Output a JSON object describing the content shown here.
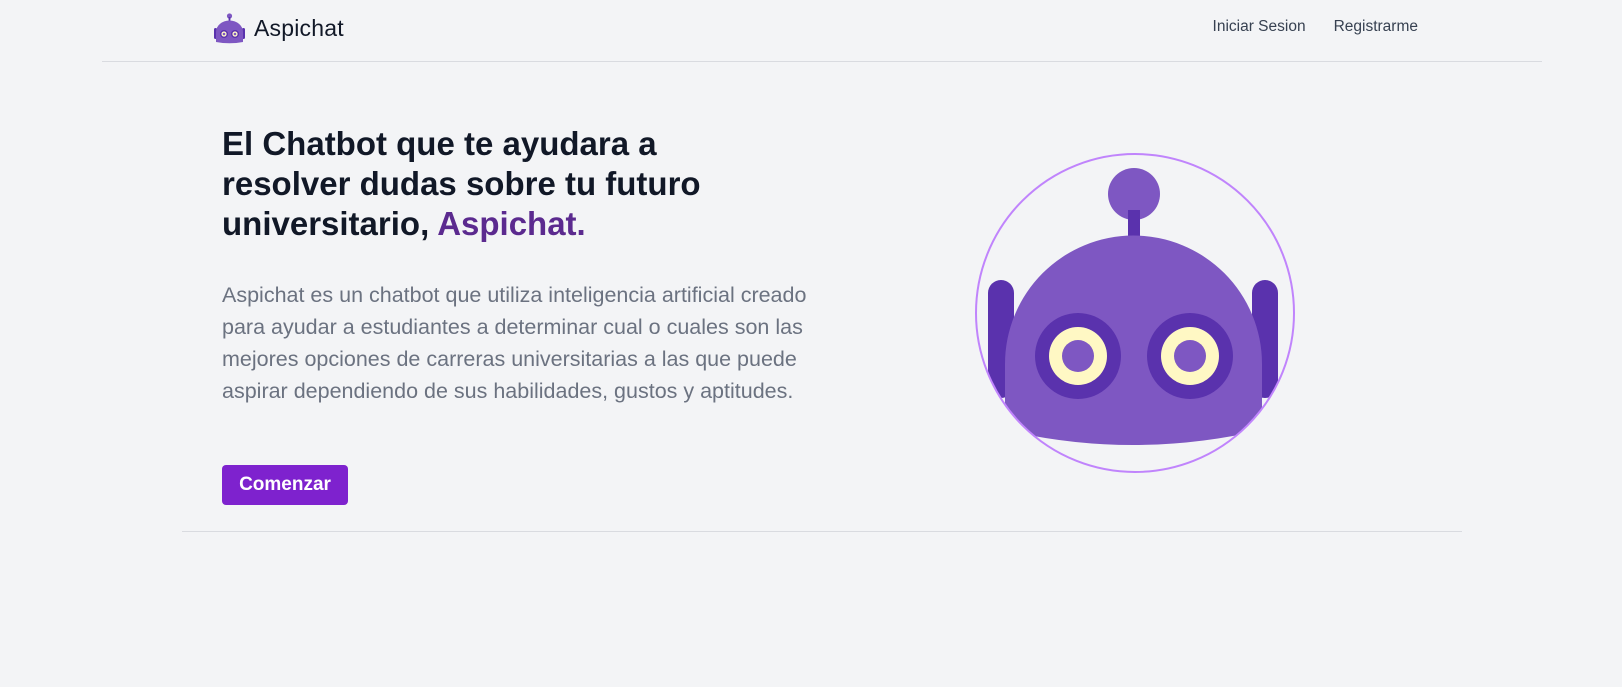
{
  "brand": {
    "name": "Aspichat",
    "logo_icon": "robot-icon",
    "color": "#7e57c2"
  },
  "nav": {
    "login_label": "Iniciar Sesion",
    "register_label": "Registrarme"
  },
  "hero": {
    "title_prefix": "El Chatbot que te ayudara a resolver dudas sobre tu futuro universitario, ",
    "title_highlight": "Aspichat.",
    "description": "Aspichat es un chatbot que utiliza inteligencia artificial creado para ayudar a estudiantes a determinar cual o cuales son las mejores opciones de carreras universitarias a las que puede aspirar dependiendo de sus habilidades, gustos y aptitudes.",
    "cta_label": "Comenzar",
    "illustration_icon": "robot-icon"
  },
  "colors": {
    "accent": "#7e22ce",
    "highlight_text": "#5b2a8f",
    "robot_body": "#7e57c2",
    "robot_dark": "#5a32ad",
    "robot_eye": "#fff8c4",
    "circle_outline": "#c084fc",
    "background": "#f3f4f6"
  }
}
